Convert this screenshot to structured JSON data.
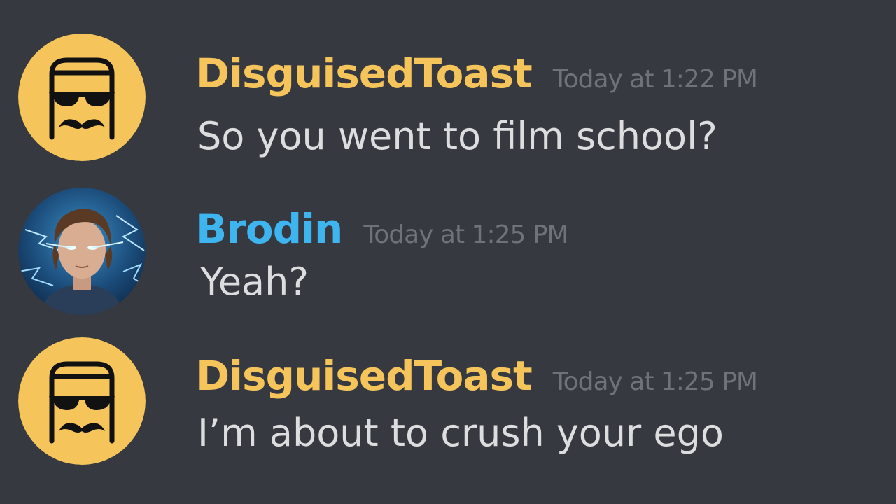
{
  "colors": {
    "background": "#36393f",
    "toast_name": "#f5c45a",
    "brodin_name": "#3fb5f0",
    "timestamp": "#6f7278",
    "message_text": "#dcddde",
    "toast_avatar_bg": "#f5c45a"
  },
  "messages": [
    {
      "author": "DisguisedToast",
      "timestamp": "Today at 1:22 PM",
      "text": "So you went to film school?",
      "avatar_icon": "toast-sunglasses-mustache-icon"
    },
    {
      "author": "Brodin",
      "timestamp": "Today at 1:25 PM",
      "text": "Yeah?",
      "avatar_icon": "user-photo-avatar"
    },
    {
      "author": "DisguisedToast",
      "timestamp": "Today at 1:25 PM",
      "text": "I’m about to crush your ego",
      "avatar_icon": "toast-sunglasses-mustache-icon"
    }
  ]
}
